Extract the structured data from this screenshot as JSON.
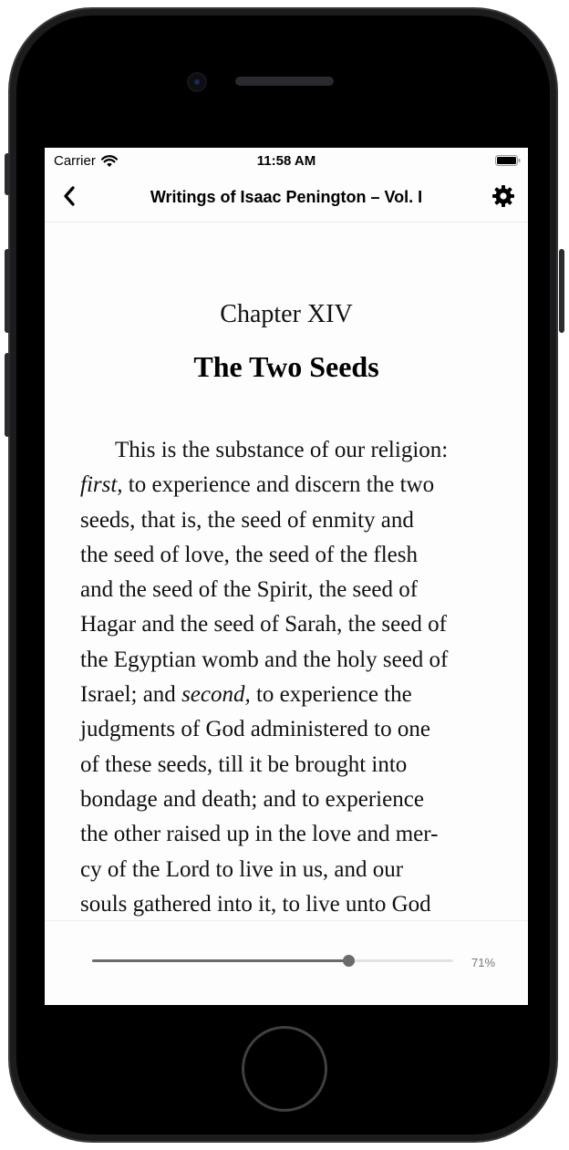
{
  "status_bar": {
    "carrier": "Carrier",
    "time": "11:58 AM"
  },
  "nav": {
    "title": "Writings of Isaac Penington – Vol. I",
    "back_icon": "chevron-left-icon",
    "settings_icon": "gear-icon"
  },
  "reader": {
    "chapter_label": "Chapter XIV",
    "chapter_title": "The Two Seeds",
    "lines": [
      "This is the substance of our religion:",
      "first,",
      " to experience and discern the two",
      "seeds, that is, the seed of enmity and",
      "the seed of love, the seed of the flesh",
      "and the seed of the Spirit, the seed of",
      "Hagar and the seed of Sarah, the seed of",
      "the Egyptian womb and the holy seed of",
      "Israel; and ",
      "second,",
      " to experience the",
      "judgments of God administered to one",
      "of these seeds, till it be brought into",
      "bondage and death; and to experience",
      "the other raised up in the love and mer-",
      "cy of the Lord to live in us, and our",
      "souls gathered into it, to live unto God"
    ]
  },
  "progress": {
    "value": 0.71,
    "label": "71%"
  },
  "colors": {
    "screen_bg": "#fdfdfd",
    "slider_fill": "#6b6b6b",
    "slider_track": "#e3e3e3",
    "percent_text": "#777777"
  }
}
